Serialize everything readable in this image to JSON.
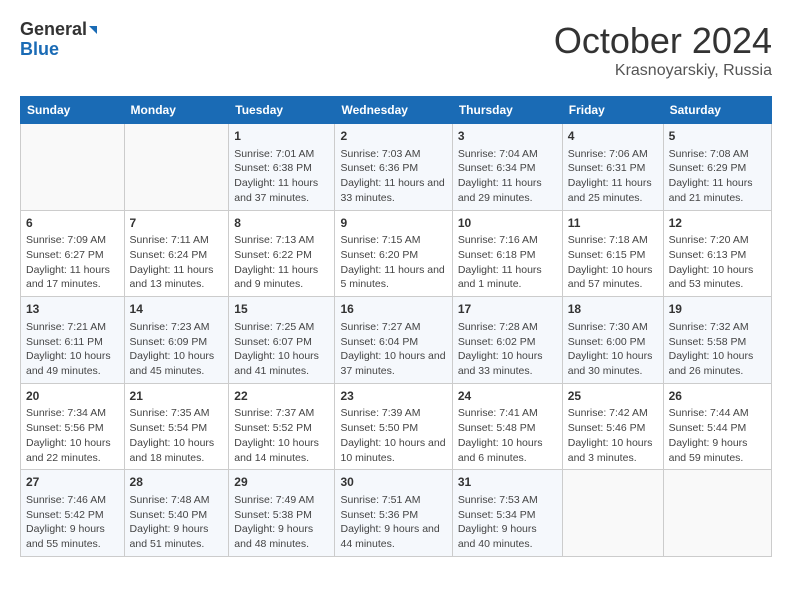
{
  "header": {
    "logo_line1": "General",
    "logo_line2": "Blue",
    "month": "October 2024",
    "location": "Krasnoyarskiy, Russia"
  },
  "weekdays": [
    "Sunday",
    "Monday",
    "Tuesday",
    "Wednesday",
    "Thursday",
    "Friday",
    "Saturday"
  ],
  "weeks": [
    [
      {
        "day": "",
        "info": ""
      },
      {
        "day": "",
        "info": ""
      },
      {
        "day": "1",
        "info": "Sunrise: 7:01 AM\nSunset: 6:38 PM\nDaylight: 11 hours and 37 minutes."
      },
      {
        "day": "2",
        "info": "Sunrise: 7:03 AM\nSunset: 6:36 PM\nDaylight: 11 hours and 33 minutes."
      },
      {
        "day": "3",
        "info": "Sunrise: 7:04 AM\nSunset: 6:34 PM\nDaylight: 11 hours and 29 minutes."
      },
      {
        "day": "4",
        "info": "Sunrise: 7:06 AM\nSunset: 6:31 PM\nDaylight: 11 hours and 25 minutes."
      },
      {
        "day": "5",
        "info": "Sunrise: 7:08 AM\nSunset: 6:29 PM\nDaylight: 11 hours and 21 minutes."
      }
    ],
    [
      {
        "day": "6",
        "info": "Sunrise: 7:09 AM\nSunset: 6:27 PM\nDaylight: 11 hours and 17 minutes."
      },
      {
        "day": "7",
        "info": "Sunrise: 7:11 AM\nSunset: 6:24 PM\nDaylight: 11 hours and 13 minutes."
      },
      {
        "day": "8",
        "info": "Sunrise: 7:13 AM\nSunset: 6:22 PM\nDaylight: 11 hours and 9 minutes."
      },
      {
        "day": "9",
        "info": "Sunrise: 7:15 AM\nSunset: 6:20 PM\nDaylight: 11 hours and 5 minutes."
      },
      {
        "day": "10",
        "info": "Sunrise: 7:16 AM\nSunset: 6:18 PM\nDaylight: 11 hours and 1 minute."
      },
      {
        "day": "11",
        "info": "Sunrise: 7:18 AM\nSunset: 6:15 PM\nDaylight: 10 hours and 57 minutes."
      },
      {
        "day": "12",
        "info": "Sunrise: 7:20 AM\nSunset: 6:13 PM\nDaylight: 10 hours and 53 minutes."
      }
    ],
    [
      {
        "day": "13",
        "info": "Sunrise: 7:21 AM\nSunset: 6:11 PM\nDaylight: 10 hours and 49 minutes."
      },
      {
        "day": "14",
        "info": "Sunrise: 7:23 AM\nSunset: 6:09 PM\nDaylight: 10 hours and 45 minutes."
      },
      {
        "day": "15",
        "info": "Sunrise: 7:25 AM\nSunset: 6:07 PM\nDaylight: 10 hours and 41 minutes."
      },
      {
        "day": "16",
        "info": "Sunrise: 7:27 AM\nSunset: 6:04 PM\nDaylight: 10 hours and 37 minutes."
      },
      {
        "day": "17",
        "info": "Sunrise: 7:28 AM\nSunset: 6:02 PM\nDaylight: 10 hours and 33 minutes."
      },
      {
        "day": "18",
        "info": "Sunrise: 7:30 AM\nSunset: 6:00 PM\nDaylight: 10 hours and 30 minutes."
      },
      {
        "day": "19",
        "info": "Sunrise: 7:32 AM\nSunset: 5:58 PM\nDaylight: 10 hours and 26 minutes."
      }
    ],
    [
      {
        "day": "20",
        "info": "Sunrise: 7:34 AM\nSunset: 5:56 PM\nDaylight: 10 hours and 22 minutes."
      },
      {
        "day": "21",
        "info": "Sunrise: 7:35 AM\nSunset: 5:54 PM\nDaylight: 10 hours and 18 minutes."
      },
      {
        "day": "22",
        "info": "Sunrise: 7:37 AM\nSunset: 5:52 PM\nDaylight: 10 hours and 14 minutes."
      },
      {
        "day": "23",
        "info": "Sunrise: 7:39 AM\nSunset: 5:50 PM\nDaylight: 10 hours and 10 minutes."
      },
      {
        "day": "24",
        "info": "Sunrise: 7:41 AM\nSunset: 5:48 PM\nDaylight: 10 hours and 6 minutes."
      },
      {
        "day": "25",
        "info": "Sunrise: 7:42 AM\nSunset: 5:46 PM\nDaylight: 10 hours and 3 minutes."
      },
      {
        "day": "26",
        "info": "Sunrise: 7:44 AM\nSunset: 5:44 PM\nDaylight: 9 hours and 59 minutes."
      }
    ],
    [
      {
        "day": "27",
        "info": "Sunrise: 7:46 AM\nSunset: 5:42 PM\nDaylight: 9 hours and 55 minutes."
      },
      {
        "day": "28",
        "info": "Sunrise: 7:48 AM\nSunset: 5:40 PM\nDaylight: 9 hours and 51 minutes."
      },
      {
        "day": "29",
        "info": "Sunrise: 7:49 AM\nSunset: 5:38 PM\nDaylight: 9 hours and 48 minutes."
      },
      {
        "day": "30",
        "info": "Sunrise: 7:51 AM\nSunset: 5:36 PM\nDaylight: 9 hours and 44 minutes."
      },
      {
        "day": "31",
        "info": "Sunrise: 7:53 AM\nSunset: 5:34 PM\nDaylight: 9 hours and 40 minutes."
      },
      {
        "day": "",
        "info": ""
      },
      {
        "day": "",
        "info": ""
      }
    ]
  ]
}
